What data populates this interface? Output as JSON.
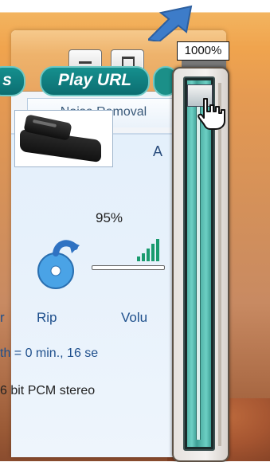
{
  "tabs": {
    "noise_removal": "Noise Removal"
  },
  "buttons": {
    "left_partial": "s",
    "play_url": "Play URL"
  },
  "labels": {
    "partial_a": "A",
    "volume_percent": "95%",
    "partial_r": "r",
    "rip": "Rip",
    "volume_partial": "Volu"
  },
  "status": {
    "length": "th =  0 min., 16 se",
    "format": "6 bit PCM stereo"
  },
  "zoom_popup": {
    "value_label": "1000%",
    "level_percent": 100
  },
  "colors": {
    "pill_teal": "#0c6e71",
    "label_blue": "#1e4f8c",
    "slider_teal": "#57b9ad",
    "annotation_arrow": "#3d7cc9"
  },
  "icons": [
    "minimize-icon",
    "maximize-icon",
    "sustain-pedal-icon",
    "rip-disc-icon",
    "volume-bars-icon",
    "hand-cursor-icon",
    "annotation-arrow-icon"
  ]
}
